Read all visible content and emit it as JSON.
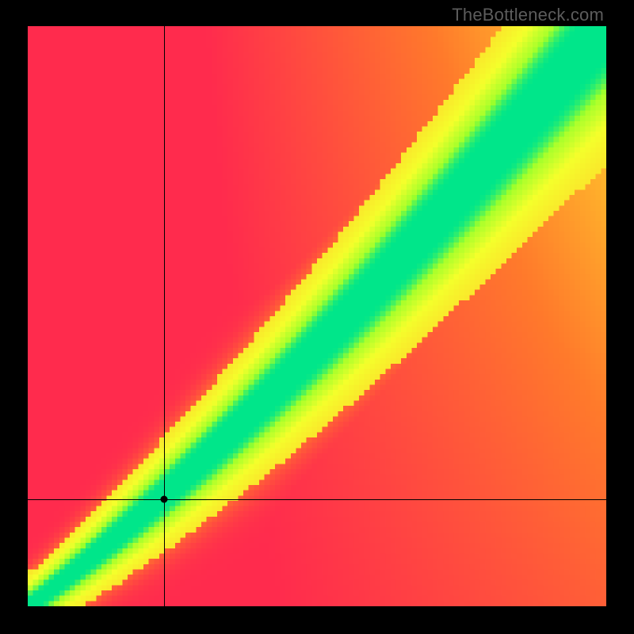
{
  "watermark": "TheBottleneck.com",
  "chart_data": {
    "type": "heatmap",
    "title": "",
    "xlabel": "",
    "ylabel": "",
    "xlim": [
      0,
      1
    ],
    "ylim": [
      0,
      1
    ],
    "grid_size": 110,
    "color_stops": [
      {
        "t": 0.0,
        "color": "#ff2b4d"
      },
      {
        "t": 0.35,
        "color": "#ff7a2b"
      },
      {
        "t": 0.6,
        "color": "#ffd22b"
      },
      {
        "t": 0.78,
        "color": "#f4ff2b"
      },
      {
        "t": 0.88,
        "color": "#9bff2b"
      },
      {
        "t": 1.0,
        "color": "#00e68a"
      }
    ],
    "optimal_band": {
      "description": "Diagonal optimal region (green) from lower-left to upper-right widening toward top-right; surrounded by yellow, falling off to red elsewhere.",
      "control_points": "y ~= x with slight downward bow below midpoint; band half-width grows from ~0.02 at origin to ~0.08 at top-right"
    },
    "crosshair": {
      "x": 0.236,
      "y": 0.185
    },
    "marker": {
      "x": 0.236,
      "y": 0.185
    }
  }
}
